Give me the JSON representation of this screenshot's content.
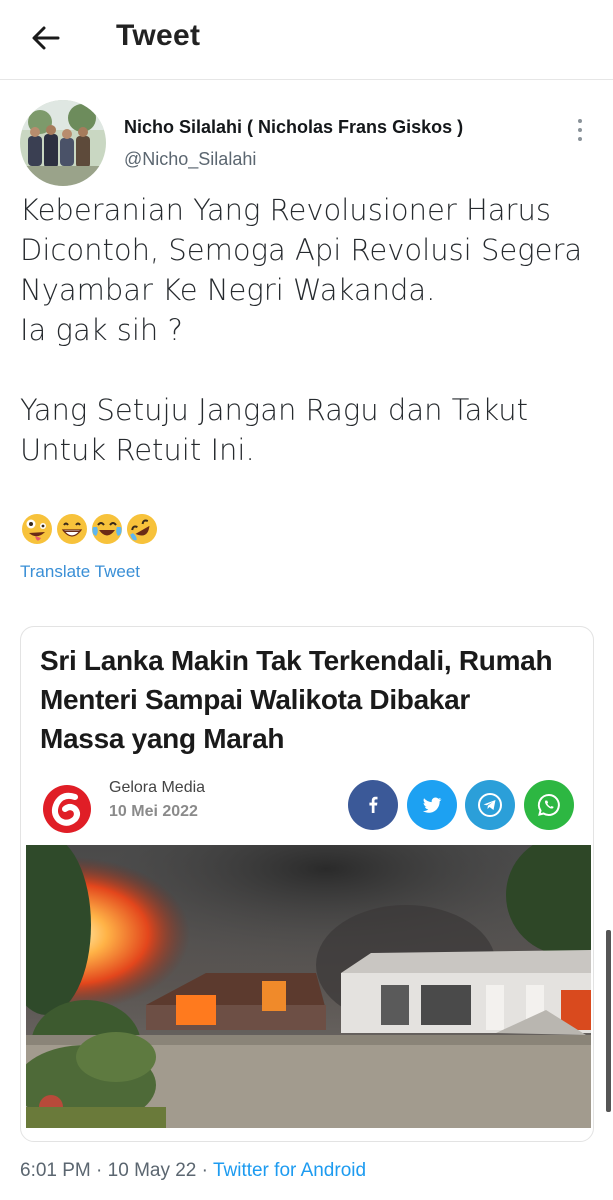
{
  "header": {
    "title": "Tweet"
  },
  "author": {
    "display_name": "Nicho Silalahi ( Nicholas Frans Giskos )",
    "handle": "@Nicho_Silalahi"
  },
  "tweet": {
    "lines": [
      "Keberanian Yang Revolusioner Harus",
      "Dicontoh, Semoga Api Revolusi Segera",
      "Nyambar Ke Negri Wakanda.",
      "Ia gak sih ?",
      "",
      "Yang Setuju Jangan Ragu dan Takut",
      "Untuk Retuit Ini."
    ],
    "emojis": [
      "zany-face",
      "grinning-face",
      "tears-of-joy",
      "rofl"
    ],
    "translate_label": "Translate Tweet"
  },
  "card": {
    "headline_lines": [
      "Sri Lanka Makin Tak Terkendali, Rumah",
      "Menteri Sampai Walikota Dibakar",
      "Massa yang Marah"
    ],
    "source_name": "Gelora Media",
    "source_date": "10 Mei 2022",
    "share_icons": [
      "facebook-icon",
      "twitter-icon",
      "telegram-icon",
      "whatsapp-icon"
    ],
    "brand_color": "#e01e26"
  },
  "meta": {
    "time": "6:01 PM",
    "separator": " · ",
    "date": "10 May 22",
    "client": "Twitter for Android"
  },
  "colors": {
    "link": "#1d9bf0",
    "translate": "#3a8fd6",
    "facebook": "#3b5998",
    "twitter": "#1da1f2",
    "telegram": "#2b9fd9",
    "whatsapp": "#2db742"
  }
}
